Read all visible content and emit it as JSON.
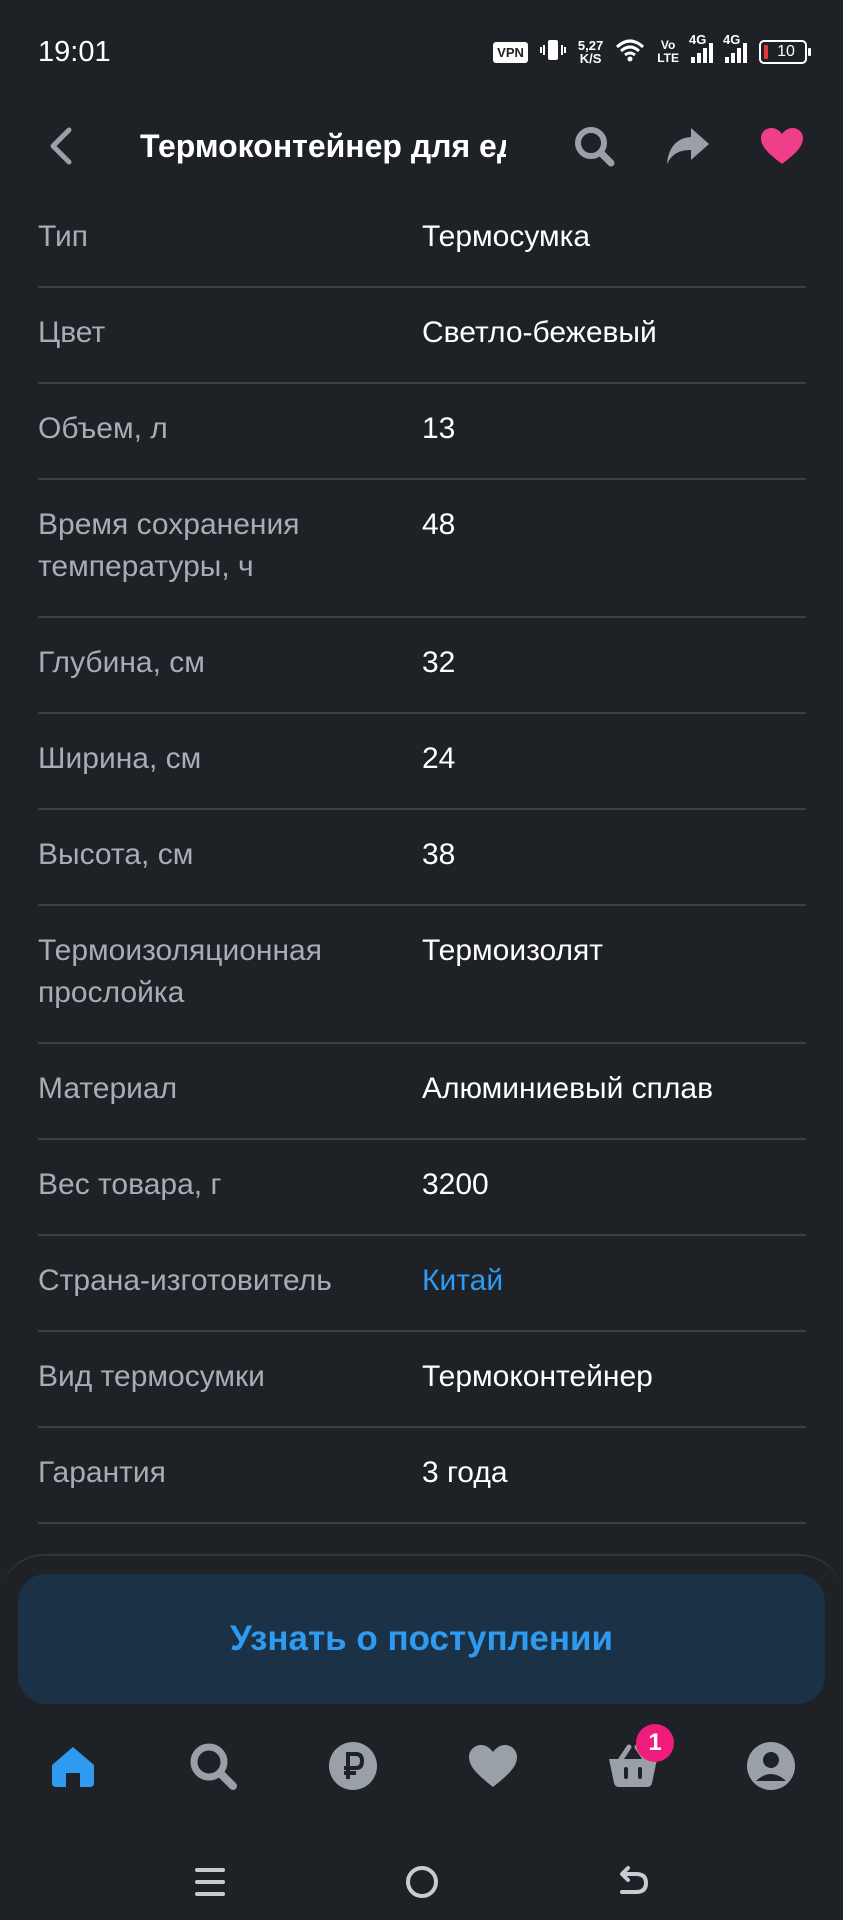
{
  "status_bar": {
    "time": "19:01",
    "vpn": "VPN",
    "speed_value": "5,27",
    "speed_unit": "K/S",
    "volte_top": "Vo",
    "volte_bottom": "LTE",
    "net1": "4G",
    "net2": "4G",
    "battery": "10",
    "battery_color": "#e53935"
  },
  "header": {
    "title": "Термоконтейнер для еды",
    "icons": [
      "back-arrow-icon",
      "search-icon",
      "share-icon",
      "heart-icon"
    ],
    "favorite_color": "#ef3f8a"
  },
  "specs": [
    {
      "key": "Тип",
      "value": "Термосумка"
    },
    {
      "key": "Цвет",
      "value": "Светло-бежевый"
    },
    {
      "key": "Объем, л",
      "value": "13"
    },
    {
      "key": "Время сохранения температуры, ч",
      "value": "48"
    },
    {
      "key": "Глубина, см",
      "value": "32"
    },
    {
      "key": "Ширина, см",
      "value": "24"
    },
    {
      "key": "Высота, см",
      "value": "38"
    },
    {
      "key": "Термоизоляционная прослойка",
      "value": "Термоизолят"
    },
    {
      "key": "Материал",
      "value": "Алюминиевый сплав"
    },
    {
      "key": "Вес товара, г",
      "value": "3200"
    },
    {
      "key": "Страна-изготовитель",
      "value": "Китай"
    },
    {
      "key": "Вид термосумки",
      "value": "Термоконтейнер"
    },
    {
      "key": "Гарантия",
      "value": "3 года"
    }
  ],
  "action": {
    "notify_label": "Узнать о поступлении"
  },
  "tabbar": {
    "items": [
      "home-icon",
      "search-icon",
      "ruble-icon",
      "favorites-icon",
      "cart-icon",
      "profile-icon"
    ],
    "cart_badge": "1",
    "active_color": "#2f9bf0",
    "inactive_color": "#9aa0a8"
  },
  "system_nav": [
    "menu-icon",
    "home-circle-icon",
    "back-icon"
  ]
}
